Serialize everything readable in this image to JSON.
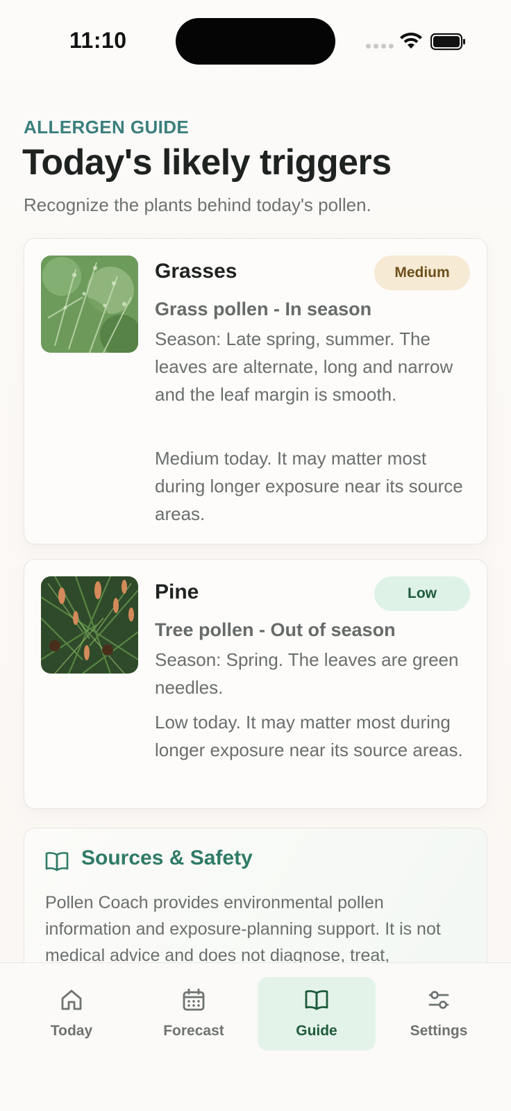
{
  "status_bar": {
    "time": "11:10"
  },
  "header": {
    "eyebrow": "ALLERGEN GUIDE",
    "title": "Today's likely triggers",
    "subtitle": "Recognize the plants behind today's pollen."
  },
  "plants": [
    {
      "name": "Grasses",
      "level": "Medium",
      "type": "Grass pollen - In season",
      "description": "Season: Late spring, summer. The leaves are alternate, long and narrow and the leaf margin is smooth.",
      "today": "Medium today. It may matter most during longer exposure near its source areas."
    },
    {
      "name": "Pine",
      "level": "Low",
      "type": "Tree pollen - Out of season",
      "description": "Season: Spring. The leaves are green needles.",
      "today": "Low today. It may matter most during longer exposure near its source areas."
    }
  ],
  "sources": {
    "title": "Sources & Safety",
    "text": "Pollen Coach provides environmental pollen information and exposure-planning support. It is not medical advice and does not diagnose, treat,"
  },
  "tabs": [
    {
      "label": "Today",
      "icon": "home-icon",
      "active": false
    },
    {
      "label": "Forecast",
      "icon": "calendar-icon",
      "active": false
    },
    {
      "label": "Guide",
      "icon": "book-icon",
      "active": true
    },
    {
      "label": "Settings",
      "icon": "sliders-icon",
      "active": false
    }
  ],
  "colors": {
    "accent_teal": "#3a7f7d",
    "accent_green": "#2f7a66",
    "badge_medium_bg": "#f7ead4",
    "badge_low_bg": "#dff2e8",
    "active_tab_bg": "#e4f3ea"
  }
}
